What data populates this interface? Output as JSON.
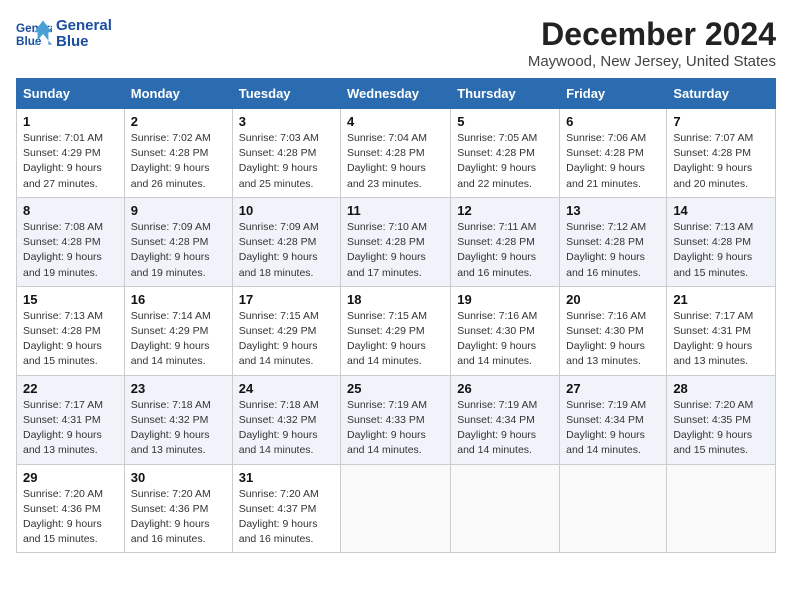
{
  "header": {
    "logo_line1": "General",
    "logo_line2": "Blue",
    "month_title": "December 2024",
    "location": "Maywood, New Jersey, United States"
  },
  "weekdays": [
    "Sunday",
    "Monday",
    "Tuesday",
    "Wednesday",
    "Thursday",
    "Friday",
    "Saturday"
  ],
  "weeks": [
    [
      {
        "day": "1",
        "sunrise": "7:01 AM",
        "sunset": "4:29 PM",
        "daylight": "9 hours and 27 minutes."
      },
      {
        "day": "2",
        "sunrise": "7:02 AM",
        "sunset": "4:28 PM",
        "daylight": "9 hours and 26 minutes."
      },
      {
        "day": "3",
        "sunrise": "7:03 AM",
        "sunset": "4:28 PM",
        "daylight": "9 hours and 25 minutes."
      },
      {
        "day": "4",
        "sunrise": "7:04 AM",
        "sunset": "4:28 PM",
        "daylight": "9 hours and 23 minutes."
      },
      {
        "day": "5",
        "sunrise": "7:05 AM",
        "sunset": "4:28 PM",
        "daylight": "9 hours and 22 minutes."
      },
      {
        "day": "6",
        "sunrise": "7:06 AM",
        "sunset": "4:28 PM",
        "daylight": "9 hours and 21 minutes."
      },
      {
        "day": "7",
        "sunrise": "7:07 AM",
        "sunset": "4:28 PM",
        "daylight": "9 hours and 20 minutes."
      }
    ],
    [
      {
        "day": "8",
        "sunrise": "7:08 AM",
        "sunset": "4:28 PM",
        "daylight": "9 hours and 19 minutes."
      },
      {
        "day": "9",
        "sunrise": "7:09 AM",
        "sunset": "4:28 PM",
        "daylight": "9 hours and 19 minutes."
      },
      {
        "day": "10",
        "sunrise": "7:09 AM",
        "sunset": "4:28 PM",
        "daylight": "9 hours and 18 minutes."
      },
      {
        "day": "11",
        "sunrise": "7:10 AM",
        "sunset": "4:28 PM",
        "daylight": "9 hours and 17 minutes."
      },
      {
        "day": "12",
        "sunrise": "7:11 AM",
        "sunset": "4:28 PM",
        "daylight": "9 hours and 16 minutes."
      },
      {
        "day": "13",
        "sunrise": "7:12 AM",
        "sunset": "4:28 PM",
        "daylight": "9 hours and 16 minutes."
      },
      {
        "day": "14",
        "sunrise": "7:13 AM",
        "sunset": "4:28 PM",
        "daylight": "9 hours and 15 minutes."
      }
    ],
    [
      {
        "day": "15",
        "sunrise": "7:13 AM",
        "sunset": "4:28 PM",
        "daylight": "9 hours and 15 minutes."
      },
      {
        "day": "16",
        "sunrise": "7:14 AM",
        "sunset": "4:29 PM",
        "daylight": "9 hours and 14 minutes."
      },
      {
        "day": "17",
        "sunrise": "7:15 AM",
        "sunset": "4:29 PM",
        "daylight": "9 hours and 14 minutes."
      },
      {
        "day": "18",
        "sunrise": "7:15 AM",
        "sunset": "4:29 PM",
        "daylight": "9 hours and 14 minutes."
      },
      {
        "day": "19",
        "sunrise": "7:16 AM",
        "sunset": "4:30 PM",
        "daylight": "9 hours and 14 minutes."
      },
      {
        "day": "20",
        "sunrise": "7:16 AM",
        "sunset": "4:30 PM",
        "daylight": "9 hours and 13 minutes."
      },
      {
        "day": "21",
        "sunrise": "7:17 AM",
        "sunset": "4:31 PM",
        "daylight": "9 hours and 13 minutes."
      }
    ],
    [
      {
        "day": "22",
        "sunrise": "7:17 AM",
        "sunset": "4:31 PM",
        "daylight": "9 hours and 13 minutes."
      },
      {
        "day": "23",
        "sunrise": "7:18 AM",
        "sunset": "4:32 PM",
        "daylight": "9 hours and 13 minutes."
      },
      {
        "day": "24",
        "sunrise": "7:18 AM",
        "sunset": "4:32 PM",
        "daylight": "9 hours and 14 minutes."
      },
      {
        "day": "25",
        "sunrise": "7:19 AM",
        "sunset": "4:33 PM",
        "daylight": "9 hours and 14 minutes."
      },
      {
        "day": "26",
        "sunrise": "7:19 AM",
        "sunset": "4:34 PM",
        "daylight": "9 hours and 14 minutes."
      },
      {
        "day": "27",
        "sunrise": "7:19 AM",
        "sunset": "4:34 PM",
        "daylight": "9 hours and 14 minutes."
      },
      {
        "day": "28",
        "sunrise": "7:20 AM",
        "sunset": "4:35 PM",
        "daylight": "9 hours and 15 minutes."
      }
    ],
    [
      {
        "day": "29",
        "sunrise": "7:20 AM",
        "sunset": "4:36 PM",
        "daylight": "9 hours and 15 minutes."
      },
      {
        "day": "30",
        "sunrise": "7:20 AM",
        "sunset": "4:36 PM",
        "daylight": "9 hours and 16 minutes."
      },
      {
        "day": "31",
        "sunrise": "7:20 AM",
        "sunset": "4:37 PM",
        "daylight": "9 hours and 16 minutes."
      },
      null,
      null,
      null,
      null
    ]
  ]
}
